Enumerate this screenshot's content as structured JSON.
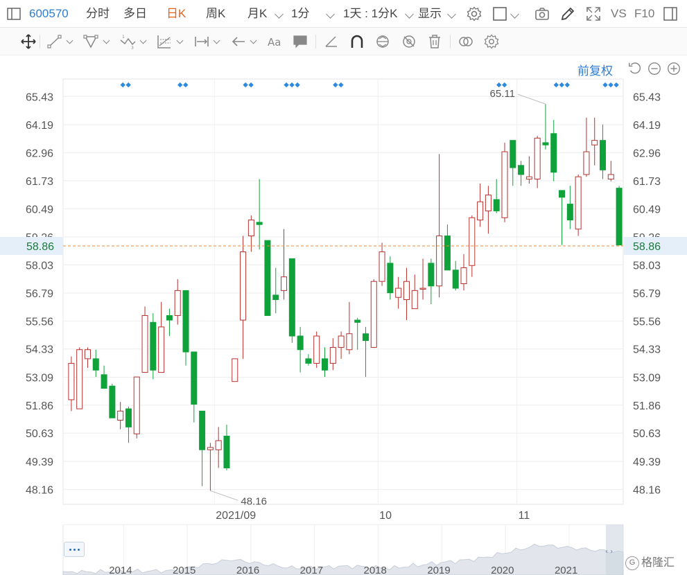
{
  "toolbar": {
    "stock_code": "600570",
    "tabs": [
      {
        "label": "分时"
      },
      {
        "label": "多日"
      },
      {
        "label": "日K",
        "active": true
      },
      {
        "label": "周K"
      },
      {
        "label": "月K"
      },
      {
        "label": "1分"
      }
    ],
    "interval_label": "1天 : 1分K",
    "display_label": "显示",
    "vs_label": "VS",
    "f10_label": "F10"
  },
  "chart": {
    "adjust_label": "前复权",
    "y_axis_ticks": [
      "65.43",
      "64.19",
      "62.96",
      "61.73",
      "60.49",
      "59.26",
      "58.03",
      "56.79",
      "55.56",
      "54.33",
      "53.09",
      "51.86",
      "50.63",
      "49.39",
      "48.16"
    ],
    "x_axis_labels": [
      "2021/09",
      "10",
      "11"
    ],
    "current_price": "58.86",
    "high_annotation": "65.11",
    "low_annotation": "48.16",
    "accent_up": "#b7312e",
    "accent_down": "#0fa23a",
    "price_line_color": "#e8893e"
  },
  "chart_data": {
    "type": "candlestick",
    "ylim": [
      47.5,
      66.2
    ],
    "candles": [
      {
        "o": 52.1,
        "h": 54.0,
        "l": 51.6,
        "c": 53.7
      },
      {
        "o": 51.7,
        "h": 54.4,
        "l": 51.7,
        "c": 54.3
      },
      {
        "o": 53.9,
        "h": 54.4,
        "l": 53.5,
        "c": 54.3
      },
      {
        "o": 53.9,
        "h": 54.3,
        "l": 53.1,
        "c": 53.4
      },
      {
        "o": 53.2,
        "h": 53.6,
        "l": 52.6,
        "c": 52.6
      },
      {
        "o": 52.7,
        "h": 52.8,
        "l": 51.3,
        "c": 51.3
      },
      {
        "o": 51.2,
        "h": 52.0,
        "l": 50.8,
        "c": 51.6
      },
      {
        "o": 51.7,
        "h": 51.8,
        "l": 50.2,
        "c": 50.9
      },
      {
        "o": 50.6,
        "h": 53.1,
        "l": 50.4,
        "c": 53.1
      },
      {
        "o": 53.3,
        "h": 56.2,
        "l": 53.3,
        "c": 55.8
      },
      {
        "o": 55.5,
        "h": 55.9,
        "l": 53.0,
        "c": 53.4
      },
      {
        "o": 53.3,
        "h": 56.4,
        "l": 53.3,
        "c": 55.3
      },
      {
        "o": 55.8,
        "h": 56.1,
        "l": 54.9,
        "c": 55.6
      },
      {
        "o": 55.8,
        "h": 57.4,
        "l": 55.4,
        "c": 56.9
      },
      {
        "o": 56.9,
        "h": 56.9,
        "l": 53.6,
        "c": 54.2
      },
      {
        "o": 54.2,
        "h": 54.2,
        "l": 51.1,
        "c": 51.9
      },
      {
        "o": 51.6,
        "h": 51.6,
        "l": 48.3,
        "c": 49.9
      },
      {
        "o": 49.9,
        "h": 50.2,
        "l": 48.1,
        "c": 50.0
      },
      {
        "o": 49.9,
        "h": 50.9,
        "l": 49.1,
        "c": 50.3
      },
      {
        "o": 50.5,
        "h": 51.0,
        "l": 49.0,
        "c": 49.1
      },
      {
        "o": 52.9,
        "h": 53.9,
        "l": 52.9,
        "c": 53.9
      },
      {
        "o": 55.6,
        "h": 59.3,
        "l": 53.9,
        "c": 58.6
      },
      {
        "o": 59.3,
        "h": 60.2,
        "l": 58.6,
        "c": 60.0
      },
      {
        "o": 59.9,
        "h": 61.8,
        "l": 58.7,
        "c": 59.8
      },
      {
        "o": 59.1,
        "h": 59.1,
        "l": 55.8,
        "c": 55.8
      },
      {
        "o": 56.7,
        "h": 57.9,
        "l": 55.9,
        "c": 56.5
      },
      {
        "o": 56.9,
        "h": 59.6,
        "l": 56.5,
        "c": 57.5
      },
      {
        "o": 58.3,
        "h": 58.3,
        "l": 54.6,
        "c": 54.9
      },
      {
        "o": 54.9,
        "h": 55.3,
        "l": 53.3,
        "c": 54.3
      },
      {
        "o": 53.9,
        "h": 54.1,
        "l": 53.6,
        "c": 53.7
      },
      {
        "o": 53.7,
        "h": 55.1,
        "l": 53.5,
        "c": 54.9
      },
      {
        "o": 53.9,
        "h": 54.4,
        "l": 53.1,
        "c": 53.4
      },
      {
        "o": 53.7,
        "h": 54.8,
        "l": 53.4,
        "c": 54.4
      },
      {
        "o": 54.4,
        "h": 55.1,
        "l": 53.9,
        "c": 54.9
      },
      {
        "o": 54.3,
        "h": 56.4,
        "l": 54.1,
        "c": 55.0
      },
      {
        "o": 55.6,
        "h": 55.7,
        "l": 54.3,
        "c": 55.5
      },
      {
        "o": 55.0,
        "h": 55.3,
        "l": 53.1,
        "c": 54.7
      },
      {
        "o": 54.4,
        "h": 57.4,
        "l": 54.4,
        "c": 57.3
      },
      {
        "o": 57.3,
        "h": 59.0,
        "l": 57.1,
        "c": 58.6
      },
      {
        "o": 58.1,
        "h": 58.4,
        "l": 56.5,
        "c": 56.8
      },
      {
        "o": 56.6,
        "h": 57.5,
        "l": 56.1,
        "c": 57.0
      },
      {
        "o": 56.5,
        "h": 57.9,
        "l": 55.6,
        "c": 57.3
      },
      {
        "o": 56.1,
        "h": 57.6,
        "l": 56.1,
        "c": 56.9
      },
      {
        "o": 57.0,
        "h": 58.3,
        "l": 56.5,
        "c": 57.0
      },
      {
        "o": 58.1,
        "h": 58.3,
        "l": 56.3,
        "c": 57.1
      },
      {
        "o": 57.1,
        "h": 62.9,
        "l": 56.6,
        "c": 59.3
      },
      {
        "o": 59.3,
        "h": 59.8,
        "l": 57.8,
        "c": 57.8
      },
      {
        "o": 57.8,
        "h": 58.2,
        "l": 56.9,
        "c": 57.0
      },
      {
        "o": 57.2,
        "h": 58.5,
        "l": 56.9,
        "c": 57.9
      },
      {
        "o": 58.0,
        "h": 60.2,
        "l": 57.5,
        "c": 60.1
      },
      {
        "o": 60.0,
        "h": 61.6,
        "l": 59.7,
        "c": 60.8
      },
      {
        "o": 60.4,
        "h": 61.5,
        "l": 59.4,
        "c": 61.1
      },
      {
        "o": 60.9,
        "h": 61.8,
        "l": 60.3,
        "c": 60.4
      },
      {
        "o": 60.1,
        "h": 63.4,
        "l": 59.9,
        "c": 63.0
      },
      {
        "o": 63.5,
        "h": 63.5,
        "l": 61.5,
        "c": 62.3
      },
      {
        "o": 62.4,
        "h": 62.6,
        "l": 61.5,
        "c": 62.0
      },
      {
        "o": 61.8,
        "h": 62.8,
        "l": 61.6,
        "c": 61.9
      },
      {
        "o": 61.8,
        "h": 63.7,
        "l": 61.4,
        "c": 63.6
      },
      {
        "o": 63.4,
        "h": 65.1,
        "l": 63.1,
        "c": 63.3
      },
      {
        "o": 63.8,
        "h": 64.4,
        "l": 61.7,
        "c": 62.1
      },
      {
        "o": 61.3,
        "h": 61.3,
        "l": 58.9,
        "c": 61.0
      },
      {
        "o": 60.7,
        "h": 61.5,
        "l": 59.6,
        "c": 60.0
      },
      {
        "o": 59.6,
        "h": 62.0,
        "l": 59.3,
        "c": 61.9
      },
      {
        "o": 62.0,
        "h": 64.5,
        "l": 61.9,
        "c": 63.0
      },
      {
        "o": 63.3,
        "h": 64.5,
        "l": 62.4,
        "c": 63.5
      },
      {
        "o": 63.5,
        "h": 64.2,
        "l": 61.8,
        "c": 62.2
      },
      {
        "o": 61.8,
        "h": 62.6,
        "l": 61.7,
        "c": 62.0
      },
      {
        "o": 61.4,
        "h": 61.5,
        "l": 58.9,
        "c": 58.9
      }
    ],
    "overview_year_labels": [
      "2014",
      "2015",
      "2016",
      "2017",
      "2018",
      "2019",
      "2020",
      "2021"
    ],
    "marker_groups": [
      {
        "count": 2,
        "after_index": 6
      },
      {
        "count": 2,
        "after_index": 13
      },
      {
        "count": 2,
        "after_index": 21
      },
      {
        "count": 3,
        "after_index": 26
      },
      {
        "count": 2,
        "after_index": 32
      },
      {
        "count": 2,
        "after_index": 52
      },
      {
        "count": 3,
        "after_index": 59
      },
      {
        "count": 3,
        "after_index": 65
      }
    ]
  }
}
